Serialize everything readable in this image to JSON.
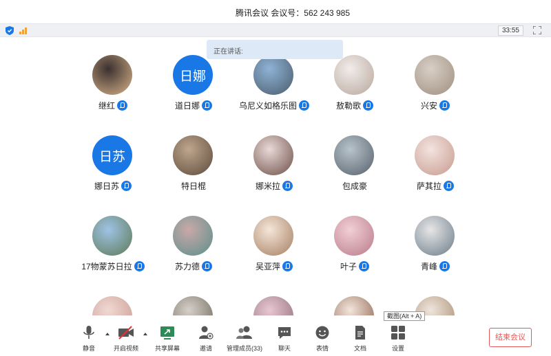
{
  "window": {
    "title": "腾讯会议 会议号：562 243 985",
    "clock": "33:55"
  },
  "speaking_banner": "正在讲话:",
  "participants": [
    {
      "name": "继红",
      "avatar_text": "",
      "mic": true
    },
    {
      "name": "道日娜",
      "avatar_text": "日娜",
      "mic": true
    },
    {
      "name": "乌尼义如格乐图",
      "avatar_text": "",
      "mic": true
    },
    {
      "name": "敖勒歌",
      "avatar_text": "",
      "mic": true
    },
    {
      "name": "兴安",
      "avatar_text": "",
      "mic": true
    },
    {
      "name": "娜日苏",
      "avatar_text": "日苏",
      "mic": true
    },
    {
      "name": "特日棍",
      "avatar_text": "",
      "mic": false
    },
    {
      "name": "娜米拉",
      "avatar_text": "",
      "mic": true
    },
    {
      "name": "包成豪",
      "avatar_text": "",
      "mic": false
    },
    {
      "name": "萨其拉",
      "avatar_text": "",
      "mic": true
    },
    {
      "name": "17物蒙苏日拉",
      "avatar_text": "",
      "mic": true
    },
    {
      "name": "苏力德",
      "avatar_text": "",
      "mic": true
    },
    {
      "name": "吴亚萍",
      "avatar_text": "",
      "mic": true
    },
    {
      "name": "叶子",
      "avatar_text": "",
      "mic": true
    },
    {
      "name": "青峰",
      "avatar_text": "",
      "mic": true
    },
    {
      "name": "",
      "avatar_text": "",
      "mic": false
    },
    {
      "name": "",
      "avatar_text": "",
      "mic": false
    },
    {
      "name": "",
      "avatar_text": "",
      "mic": false
    },
    {
      "name": "",
      "avatar_text": "",
      "mic": false
    },
    {
      "name": "",
      "avatar_text": "",
      "mic": false
    }
  ],
  "tooltip": "截图(Alt + A)",
  "toolbar": {
    "mute": "静音",
    "video": "开启视频",
    "share": "共享屏幕",
    "invite": "邀请",
    "members": "管理成员(33)",
    "chat": "聊天",
    "emoji": "表情",
    "docs": "文档",
    "settings": "设置",
    "end": "结束会议"
  },
  "colors": {
    "accent": "#1a78e6",
    "end_meeting": "#e05a5a",
    "share_icon": "#2e8b57",
    "video_off": "#d9363e"
  }
}
